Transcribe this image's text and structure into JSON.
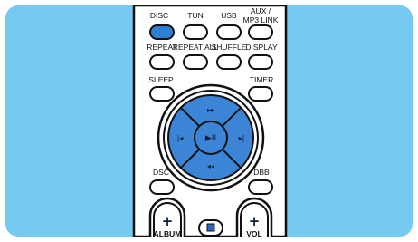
{
  "colors": {
    "background": "#76c9f0",
    "remote_body": "#ffffff",
    "outline": "#111111",
    "highlight": "#2f7fd0",
    "dpad_fill": "#3c84d6"
  },
  "remote": {
    "row1": [
      {
        "label": "DISC",
        "highlighted": true
      },
      {
        "label": "TUN",
        "highlighted": false
      },
      {
        "label": "USB",
        "highlighted": false
      },
      {
        "label_line1": "AUX /",
        "label_line2": "MP3 LINK",
        "highlighted": false
      }
    ],
    "row2": [
      {
        "label": "REPEAT"
      },
      {
        "label": "REPEAT ALL"
      },
      {
        "label": "SHUFFLE"
      },
      {
        "label": "DISPLAY"
      }
    ],
    "row3": {
      "left": {
        "label": "SLEEP"
      },
      "right": {
        "label": "TIMER"
      }
    },
    "dpad": {
      "up_icon": "fast-forward-icon",
      "down_icon": "rewind-icon",
      "left_icon": "previous-track-icon",
      "right_icon": "next-track-icon",
      "center_icon": "play-pause-icon",
      "up_symbol": "▸▸",
      "down_symbol": "◂◂",
      "left_symbol": "|◂",
      "right_symbol": "▸|",
      "center_symbol": "▶II"
    },
    "row4": {
      "left": {
        "label": "DSC"
      },
      "right": {
        "label": "DBB"
      }
    },
    "bottom": {
      "left_rocker": {
        "symbol": "+",
        "label": "ALBUM"
      },
      "stop": {
        "icon": "stop-icon"
      },
      "right_rocker": {
        "symbol": "+",
        "label": "VOL"
      }
    }
  }
}
